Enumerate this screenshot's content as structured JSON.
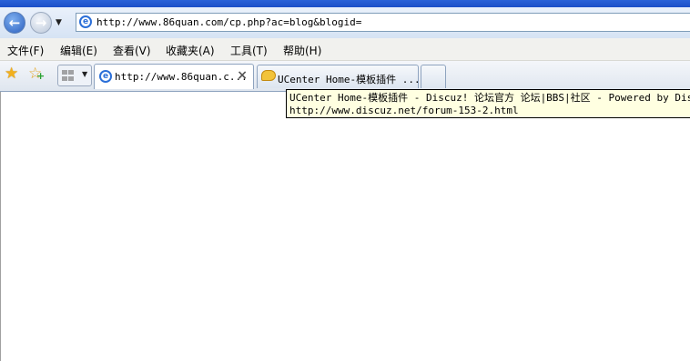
{
  "address_bar": {
    "url": "http://www.86quan.com/cp.php?ac=blog&blogid="
  },
  "menu": [
    {
      "label": "文件(F)"
    },
    {
      "label": "编辑(E)"
    },
    {
      "label": "查看(V)"
    },
    {
      "label": "收藏夹(A)"
    },
    {
      "label": "工具(T)"
    },
    {
      "label": "帮助(H)"
    }
  ],
  "tabs": [
    {
      "title": "http://www.86quan.c...",
      "active": true,
      "icon": "ie-page-icon"
    },
    {
      "title": "UCenter Home-模板插件 ...",
      "active": false,
      "icon": "chat-bubble-icon"
    }
  ],
  "tooltip": {
    "line1": "UCenter Home-模板插件 - Discuz! 论坛官方 论坛|BBS|社区 - Powered by Discuz",
    "line2": "http://www.discuz.net/forum-153-2.html"
  },
  "colors": {
    "titlebar": "#1b4fc8",
    "tooltip_bg": "#ffffe1",
    "favorites_star": "#f2b01e"
  }
}
